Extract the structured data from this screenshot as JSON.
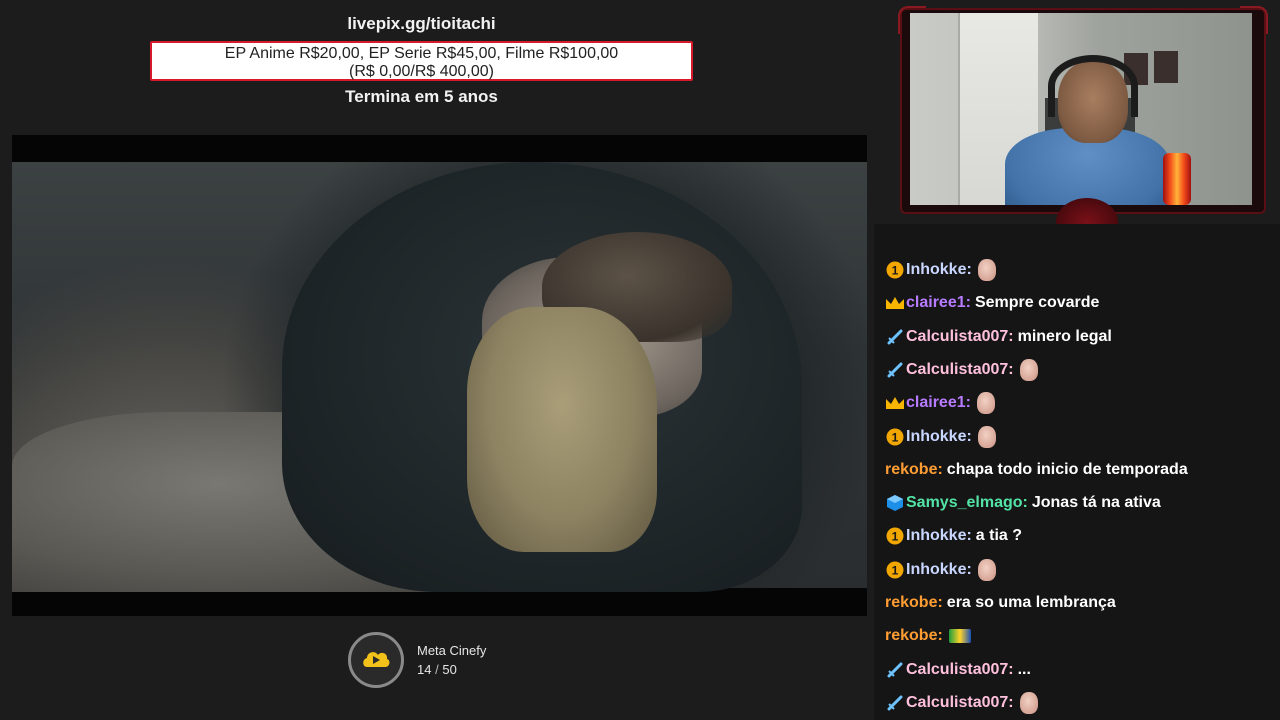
{
  "goal": {
    "url": "livepix.gg/tioitachi",
    "line1": "EP Anime R$20,00, EP Serie R$45,00, Filme R$100,00",
    "line2": "(R$ 0,00/R$ 400,00)",
    "ends": "Termina em 5 anos"
  },
  "meta": {
    "name": "Meta Cinefy",
    "current": "14",
    "separator": "/",
    "total": "50",
    "icon": "cinefy-play-icon"
  },
  "colors": {
    "accent_red": "#d6192b",
    "background": "#1c1c1d"
  },
  "chat": {
    "messages": [
      {
        "badge": "number-one-badge-icon",
        "user": "Inhokke:",
        "user_color": "#c9d6ff",
        "text": "",
        "emote": "face-emote-icon"
      },
      {
        "badge": "crown-badge-icon",
        "user": "clairee1:",
        "user_color": "#b77bff",
        "text": "Sempre covarde",
        "emote": ""
      },
      {
        "badge": "sword-badge-icon",
        "user": "Calculista007:",
        "user_color": "#ffc0dc",
        "text": "minero legal",
        "emote": ""
      },
      {
        "badge": "sword-badge-icon",
        "user": "Calculista007:",
        "user_color": "#ffc0dc",
        "text": "",
        "emote": "face-emote-icon"
      },
      {
        "badge": "crown-badge-icon",
        "user": "clairee1:",
        "user_color": "#b77bff",
        "text": "",
        "emote": "face-emote-icon"
      },
      {
        "badge": "number-one-badge-icon",
        "user": "Inhokke:",
        "user_color": "#c9d6ff",
        "text": "",
        "emote": "face-emote-icon"
      },
      {
        "badge": "",
        "user": "rekobe:",
        "user_color": "#ff9d33",
        "text": "chapa todo inicio de temporada",
        "emote": ""
      },
      {
        "badge": "cube-badge-icon",
        "user": "Samys_elmago:",
        "user_color": "#52e3a5",
        "text": "Jonas tá na ativa",
        "emote": ""
      },
      {
        "badge": "number-one-badge-icon",
        "user": "Inhokke:",
        "user_color": "#c9d6ff",
        "text": "a tia ?",
        "emote": ""
      },
      {
        "badge": "number-one-badge-icon",
        "user": "Inhokke:",
        "user_color": "#c9d6ff",
        "text": "",
        "emote": "face-emote-icon"
      },
      {
        "badge": "",
        "user": "rekobe:",
        "user_color": "#ff9d33",
        "text": "era so uma lembrança",
        "emote": ""
      },
      {
        "badge": "",
        "user": "rekobe:",
        "user_color": "#ff9d33",
        "text": "",
        "emote": "flag-emote-icon"
      },
      {
        "badge": "sword-badge-icon",
        "user": "Calculista007:",
        "user_color": "#ffc0dc",
        "text": "...",
        "emote": ""
      },
      {
        "badge": "sword-badge-icon",
        "user": "Calculista007:",
        "user_color": "#ffc0dc",
        "text": "",
        "emote": "face-emote-icon"
      }
    ]
  }
}
